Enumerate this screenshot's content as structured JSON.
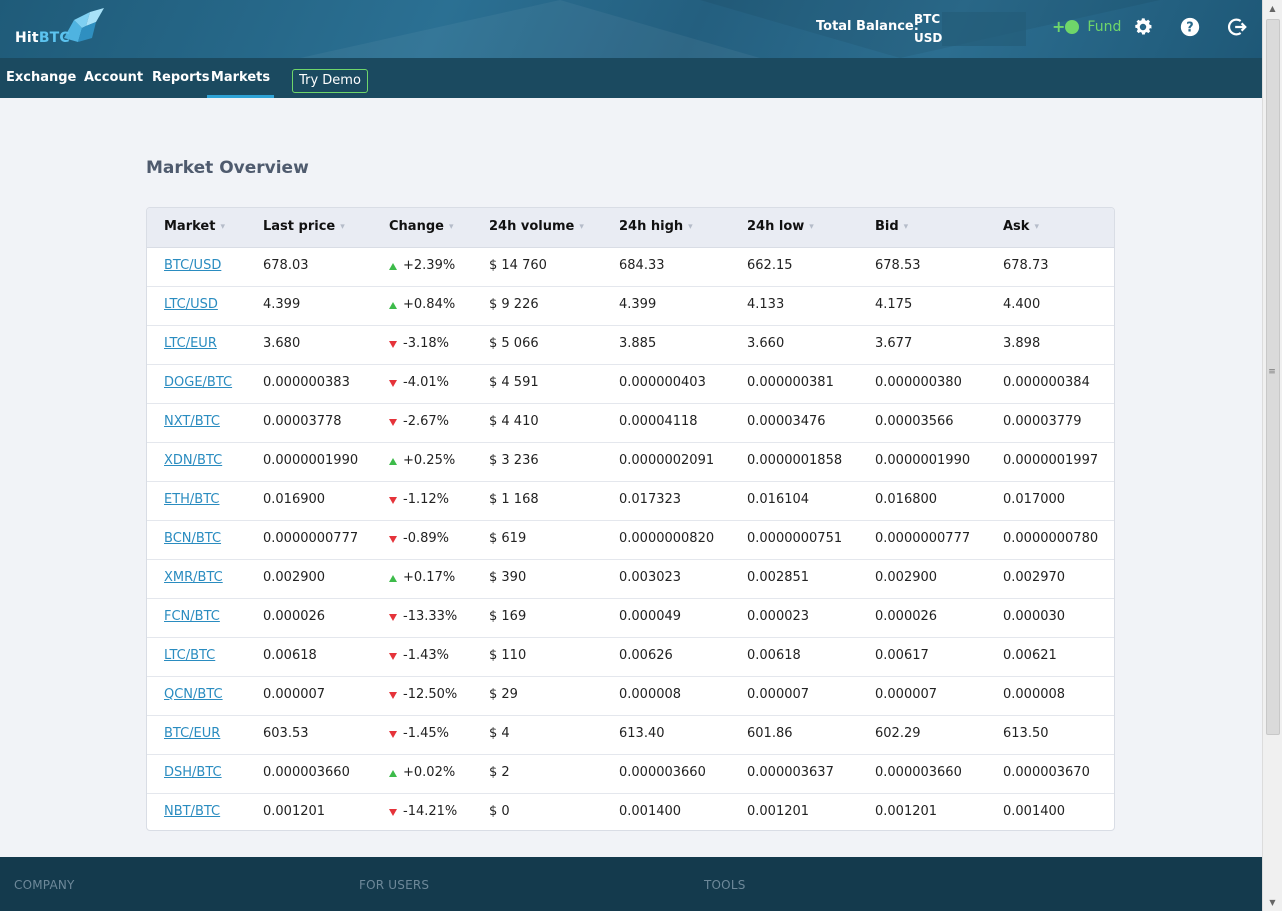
{
  "header": {
    "logo_hit": "Hit",
    "logo_btc": "BTC",
    "total_balance_label": "Total Balance:",
    "balance_btc": "BTC",
    "balance_usd": "USD",
    "fund_label": "Fund",
    "accent_green": "#6fd66a"
  },
  "nav": {
    "exchange": "Exchange",
    "account": "Account",
    "reports": "Reports",
    "markets": "Markets",
    "try_demo": "Try Demo",
    "active": "Markets"
  },
  "main": {
    "title": "Market Overview",
    "columns": [
      "Market",
      "Last price",
      "Change",
      "24h volume",
      "24h high",
      "24h low",
      "Bid",
      "Ask"
    ],
    "rows": [
      {
        "market": "BTC/USD",
        "last": "678.03",
        "dir": "up",
        "change": "+2.39%",
        "volume": "$ 14 760",
        "high": "684.33",
        "low": "662.15",
        "bid": "678.53",
        "ask": "678.73"
      },
      {
        "market": "LTC/USD",
        "last": "4.399",
        "dir": "up",
        "change": "+0.84%",
        "volume": "$ 9 226",
        "high": "4.399",
        "low": "4.133",
        "bid": "4.175",
        "ask": "4.400"
      },
      {
        "market": "LTC/EUR",
        "last": "3.680",
        "dir": "down",
        "change": "-3.18%",
        "volume": "$ 5 066",
        "high": "3.885",
        "low": "3.660",
        "bid": "3.677",
        "ask": "3.898"
      },
      {
        "market": "DOGE/BTC",
        "last": "0.000000383",
        "dir": "down",
        "change": "-4.01%",
        "volume": "$ 4 591",
        "high": "0.000000403",
        "low": "0.000000381",
        "bid": "0.000000380",
        "ask": "0.000000384"
      },
      {
        "market": "NXT/BTC",
        "last": "0.00003778",
        "dir": "down",
        "change": "-2.67%",
        "volume": "$ 4 410",
        "high": "0.00004118",
        "low": "0.00003476",
        "bid": "0.00003566",
        "ask": "0.00003779"
      },
      {
        "market": "XDN/BTC",
        "last": "0.0000001990",
        "dir": "up",
        "change": "+0.25%",
        "volume": "$ 3 236",
        "high": "0.0000002091",
        "low": "0.0000001858",
        "bid": "0.0000001990",
        "ask": "0.0000001997"
      },
      {
        "market": "ETH/BTC",
        "last": "0.016900",
        "dir": "down",
        "change": "-1.12%",
        "volume": "$ 1 168",
        "high": "0.017323",
        "low": "0.016104",
        "bid": "0.016800",
        "ask": "0.017000"
      },
      {
        "market": "BCN/BTC",
        "last": "0.0000000777",
        "dir": "down",
        "change": "-0.89%",
        "volume": "$ 619",
        "high": "0.0000000820",
        "low": "0.0000000751",
        "bid": "0.0000000777",
        "ask": "0.0000000780"
      },
      {
        "market": "XMR/BTC",
        "last": "0.002900",
        "dir": "up",
        "change": "+0.17%",
        "volume": "$ 390",
        "high": "0.003023",
        "low": "0.002851",
        "bid": "0.002900",
        "ask": "0.002970"
      },
      {
        "market": "FCN/BTC",
        "last": "0.000026",
        "dir": "down",
        "change": "-13.33%",
        "volume": "$ 169",
        "high": "0.000049",
        "low": "0.000023",
        "bid": "0.000026",
        "ask": "0.000030"
      },
      {
        "market": "LTC/BTC",
        "last": "0.00618",
        "dir": "down",
        "change": "-1.43%",
        "volume": "$ 110",
        "high": "0.00626",
        "low": "0.00618",
        "bid": "0.00617",
        "ask": "0.00621"
      },
      {
        "market": "QCN/BTC",
        "last": "0.000007",
        "dir": "down",
        "change": "-12.50%",
        "volume": "$ 29",
        "high": "0.000008",
        "low": "0.000007",
        "bid": "0.000007",
        "ask": "0.000008"
      },
      {
        "market": "BTC/EUR",
        "last": "603.53",
        "dir": "down",
        "change": "-1.45%",
        "volume": "$ 4",
        "high": "613.40",
        "low": "601.86",
        "bid": "602.29",
        "ask": "613.50"
      },
      {
        "market": "DSH/BTC",
        "last": "0.000003660",
        "dir": "up",
        "change": "+0.02%",
        "volume": "$ 2",
        "high": "0.000003660",
        "low": "0.000003637",
        "bid": "0.000003660",
        "ask": "0.000003670"
      },
      {
        "market": "NBT/BTC",
        "last": "0.001201",
        "dir": "down",
        "change": "-14.21%",
        "volume": "$ 0",
        "high": "0.001400",
        "low": "0.001201",
        "bid": "0.001201",
        "ask": "0.001400"
      }
    ]
  },
  "footer": {
    "company": "COMPANY",
    "for_users": "FOR USERS",
    "tools": "TOOLS"
  },
  "icons": {
    "fund": "plus-coin-icon",
    "settings": "gear-icon",
    "help": "help-icon",
    "logout": "logout-icon",
    "sort": "chevron-down-icon"
  }
}
